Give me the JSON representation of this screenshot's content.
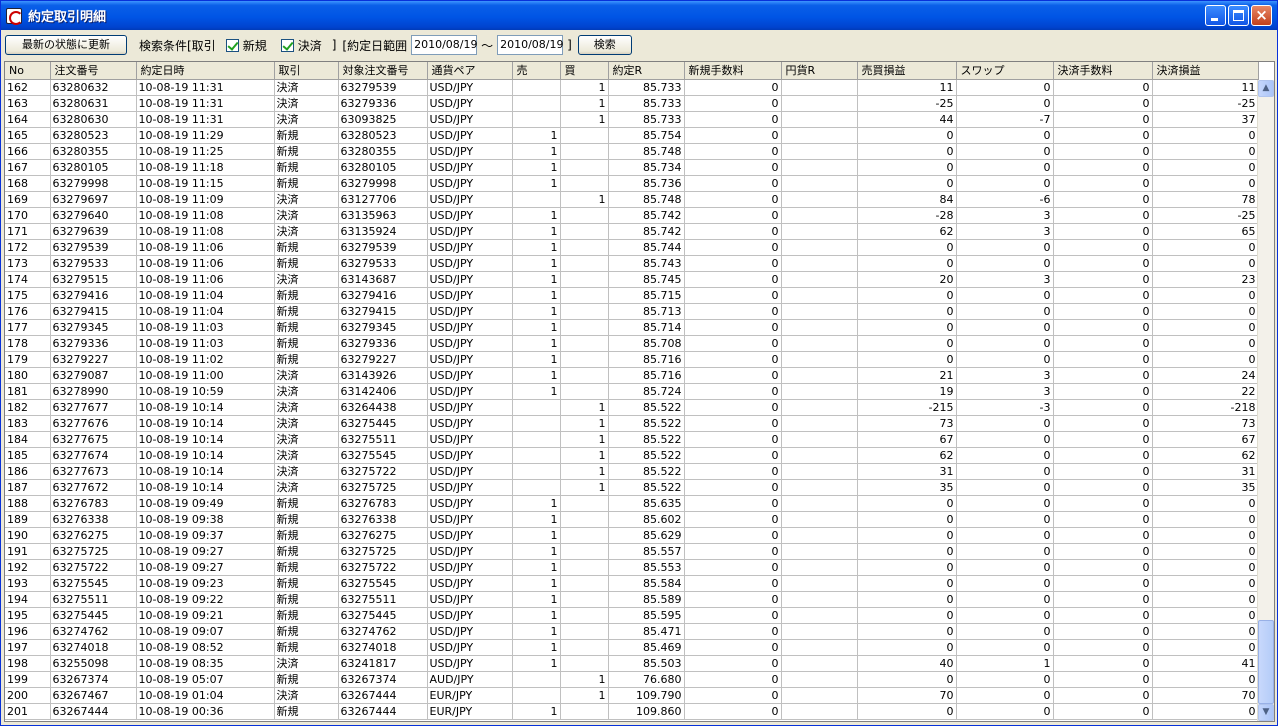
{
  "window": {
    "title": "約定取引明細"
  },
  "toolbar": {
    "refresh_label": "最新の状態に更新",
    "condition_label": "検索条件[取引",
    "new_label": "新規",
    "settle_label": "決済",
    "close_bracket": "]",
    "date_range_label": "[約定日範囲",
    "date_from": "2010/08/19",
    "tilde": "〜",
    "date_to": "2010/08/19",
    "date_close": "]",
    "search_label": "検索"
  },
  "table": {
    "columns": [
      "No",
      "注文番号",
      "約定日時",
      "取引",
      "対象注文番号",
      "通貨ペア",
      "売",
      "買",
      "約定R",
      "新規手数料",
      "円貨R",
      "売買損益",
      "スワップ",
      "決済手数料",
      "決済損益"
    ],
    "rows": [
      [
        "162",
        "63280632",
        "10-08-19 11:31",
        "決済",
        "63279539",
        "USD/JPY",
        "",
        "1",
        "85.733",
        "0",
        "",
        "11",
        "0",
        "0",
        "11"
      ],
      [
        "163",
        "63280631",
        "10-08-19 11:31",
        "決済",
        "63279336",
        "USD/JPY",
        "",
        "1",
        "85.733",
        "0",
        "",
        "-25",
        "0",
        "0",
        "-25"
      ],
      [
        "164",
        "63280630",
        "10-08-19 11:31",
        "決済",
        "63093825",
        "USD/JPY",
        "",
        "1",
        "85.733",
        "0",
        "",
        "44",
        "-7",
        "0",
        "37"
      ],
      [
        "165",
        "63280523",
        "10-08-19 11:29",
        "新規",
        "63280523",
        "USD/JPY",
        "1",
        "",
        "85.754",
        "0",
        "",
        "0",
        "0",
        "0",
        "0"
      ],
      [
        "166",
        "63280355",
        "10-08-19 11:25",
        "新規",
        "63280355",
        "USD/JPY",
        "1",
        "",
        "85.748",
        "0",
        "",
        "0",
        "0",
        "0",
        "0"
      ],
      [
        "167",
        "63280105",
        "10-08-19 11:18",
        "新規",
        "63280105",
        "USD/JPY",
        "1",
        "",
        "85.734",
        "0",
        "",
        "0",
        "0",
        "0",
        "0"
      ],
      [
        "168",
        "63279998",
        "10-08-19 11:15",
        "新規",
        "63279998",
        "USD/JPY",
        "1",
        "",
        "85.736",
        "0",
        "",
        "0",
        "0",
        "0",
        "0"
      ],
      [
        "169",
        "63279697",
        "10-08-19 11:09",
        "決済",
        "63127706",
        "USD/JPY",
        "",
        "1",
        "85.748",
        "0",
        "",
        "84",
        "-6",
        "0",
        "78"
      ],
      [
        "170",
        "63279640",
        "10-08-19 11:08",
        "決済",
        "63135963",
        "USD/JPY",
        "1",
        "",
        "85.742",
        "0",
        "",
        "-28",
        "3",
        "0",
        "-25"
      ],
      [
        "171",
        "63279639",
        "10-08-19 11:08",
        "決済",
        "63135924",
        "USD/JPY",
        "1",
        "",
        "85.742",
        "0",
        "",
        "62",
        "3",
        "0",
        "65"
      ],
      [
        "172",
        "63279539",
        "10-08-19 11:06",
        "新規",
        "63279539",
        "USD/JPY",
        "1",
        "",
        "85.744",
        "0",
        "",
        "0",
        "0",
        "0",
        "0"
      ],
      [
        "173",
        "63279533",
        "10-08-19 11:06",
        "新規",
        "63279533",
        "USD/JPY",
        "1",
        "",
        "85.743",
        "0",
        "",
        "0",
        "0",
        "0",
        "0"
      ],
      [
        "174",
        "63279515",
        "10-08-19 11:06",
        "決済",
        "63143687",
        "USD/JPY",
        "1",
        "",
        "85.745",
        "0",
        "",
        "20",
        "3",
        "0",
        "23"
      ],
      [
        "175",
        "63279416",
        "10-08-19 11:04",
        "新規",
        "63279416",
        "USD/JPY",
        "1",
        "",
        "85.715",
        "0",
        "",
        "0",
        "0",
        "0",
        "0"
      ],
      [
        "176",
        "63279415",
        "10-08-19 11:04",
        "新規",
        "63279415",
        "USD/JPY",
        "1",
        "",
        "85.713",
        "0",
        "",
        "0",
        "0",
        "0",
        "0"
      ],
      [
        "177",
        "63279345",
        "10-08-19 11:03",
        "新規",
        "63279345",
        "USD/JPY",
        "1",
        "",
        "85.714",
        "0",
        "",
        "0",
        "0",
        "0",
        "0"
      ],
      [
        "178",
        "63279336",
        "10-08-19 11:03",
        "新規",
        "63279336",
        "USD/JPY",
        "1",
        "",
        "85.708",
        "0",
        "",
        "0",
        "0",
        "0",
        "0"
      ],
      [
        "179",
        "63279227",
        "10-08-19 11:02",
        "新規",
        "63279227",
        "USD/JPY",
        "1",
        "",
        "85.716",
        "0",
        "",
        "0",
        "0",
        "0",
        "0"
      ],
      [
        "180",
        "63279087",
        "10-08-19 11:00",
        "決済",
        "63143926",
        "USD/JPY",
        "1",
        "",
        "85.716",
        "0",
        "",
        "21",
        "3",
        "0",
        "24"
      ],
      [
        "181",
        "63278990",
        "10-08-19 10:59",
        "決済",
        "63142406",
        "USD/JPY",
        "1",
        "",
        "85.724",
        "0",
        "",
        "19",
        "3",
        "0",
        "22"
      ],
      [
        "182",
        "63277677",
        "10-08-19 10:14",
        "決済",
        "63264438",
        "USD/JPY",
        "",
        "1",
        "85.522",
        "0",
        "",
        "-215",
        "-3",
        "0",
        "-218"
      ],
      [
        "183",
        "63277676",
        "10-08-19 10:14",
        "決済",
        "63275445",
        "USD/JPY",
        "",
        "1",
        "85.522",
        "0",
        "",
        "73",
        "0",
        "0",
        "73"
      ],
      [
        "184",
        "63277675",
        "10-08-19 10:14",
        "決済",
        "63275511",
        "USD/JPY",
        "",
        "1",
        "85.522",
        "0",
        "",
        "67",
        "0",
        "0",
        "67"
      ],
      [
        "185",
        "63277674",
        "10-08-19 10:14",
        "決済",
        "63275545",
        "USD/JPY",
        "",
        "1",
        "85.522",
        "0",
        "",
        "62",
        "0",
        "0",
        "62"
      ],
      [
        "186",
        "63277673",
        "10-08-19 10:14",
        "決済",
        "63275722",
        "USD/JPY",
        "",
        "1",
        "85.522",
        "0",
        "",
        "31",
        "0",
        "0",
        "31"
      ],
      [
        "187",
        "63277672",
        "10-08-19 10:14",
        "決済",
        "63275725",
        "USD/JPY",
        "",
        "1",
        "85.522",
        "0",
        "",
        "35",
        "0",
        "0",
        "35"
      ],
      [
        "188",
        "63276783",
        "10-08-19 09:49",
        "新規",
        "63276783",
        "USD/JPY",
        "1",
        "",
        "85.635",
        "0",
        "",
        "0",
        "0",
        "0",
        "0"
      ],
      [
        "189",
        "63276338",
        "10-08-19 09:38",
        "新規",
        "63276338",
        "USD/JPY",
        "1",
        "",
        "85.602",
        "0",
        "",
        "0",
        "0",
        "0",
        "0"
      ],
      [
        "190",
        "63276275",
        "10-08-19 09:37",
        "新規",
        "63276275",
        "USD/JPY",
        "1",
        "",
        "85.629",
        "0",
        "",
        "0",
        "0",
        "0",
        "0"
      ],
      [
        "191",
        "63275725",
        "10-08-19 09:27",
        "新規",
        "63275725",
        "USD/JPY",
        "1",
        "",
        "85.557",
        "0",
        "",
        "0",
        "0",
        "0",
        "0"
      ],
      [
        "192",
        "63275722",
        "10-08-19 09:27",
        "新規",
        "63275722",
        "USD/JPY",
        "1",
        "",
        "85.553",
        "0",
        "",
        "0",
        "0",
        "0",
        "0"
      ],
      [
        "193",
        "63275545",
        "10-08-19 09:23",
        "新規",
        "63275545",
        "USD/JPY",
        "1",
        "",
        "85.584",
        "0",
        "",
        "0",
        "0",
        "0",
        "0"
      ],
      [
        "194",
        "63275511",
        "10-08-19 09:22",
        "新規",
        "63275511",
        "USD/JPY",
        "1",
        "",
        "85.589",
        "0",
        "",
        "0",
        "0",
        "0",
        "0"
      ],
      [
        "195",
        "63275445",
        "10-08-19 09:21",
        "新規",
        "63275445",
        "USD/JPY",
        "1",
        "",
        "85.595",
        "0",
        "",
        "0",
        "0",
        "0",
        "0"
      ],
      [
        "196",
        "63274762",
        "10-08-19 09:07",
        "新規",
        "63274762",
        "USD/JPY",
        "1",
        "",
        "85.471",
        "0",
        "",
        "0",
        "0",
        "0",
        "0"
      ],
      [
        "197",
        "63274018",
        "10-08-19 08:52",
        "新規",
        "63274018",
        "USD/JPY",
        "1",
        "",
        "85.469",
        "0",
        "",
        "0",
        "0",
        "0",
        "0"
      ],
      [
        "198",
        "63255098",
        "10-08-19 08:35",
        "決済",
        "63241817",
        "USD/JPY",
        "1",
        "",
        "85.503",
        "0",
        "",
        "40",
        "1",
        "0",
        "41"
      ],
      [
        "199",
        "63267374",
        "10-08-19 05:07",
        "新規",
        "63267374",
        "AUD/JPY",
        "",
        "1",
        "76.680",
        "0",
        "",
        "0",
        "0",
        "0",
        "0"
      ],
      [
        "200",
        "63267467",
        "10-08-19 01:04",
        "決済",
        "63267444",
        "EUR/JPY",
        "",
        "1",
        "109.790",
        "0",
        "",
        "70",
        "0",
        "0",
        "70"
      ],
      [
        "201",
        "63267444",
        "10-08-19 00:36",
        "新規",
        "63267444",
        "EUR/JPY",
        "1",
        "",
        "109.860",
        "0",
        "",
        "0",
        "0",
        "0",
        "0"
      ]
    ]
  },
  "scrollbar": {
    "up_icon": "▲",
    "down_icon": "▼"
  },
  "window_controls": {
    "close_glyph": "×"
  }
}
